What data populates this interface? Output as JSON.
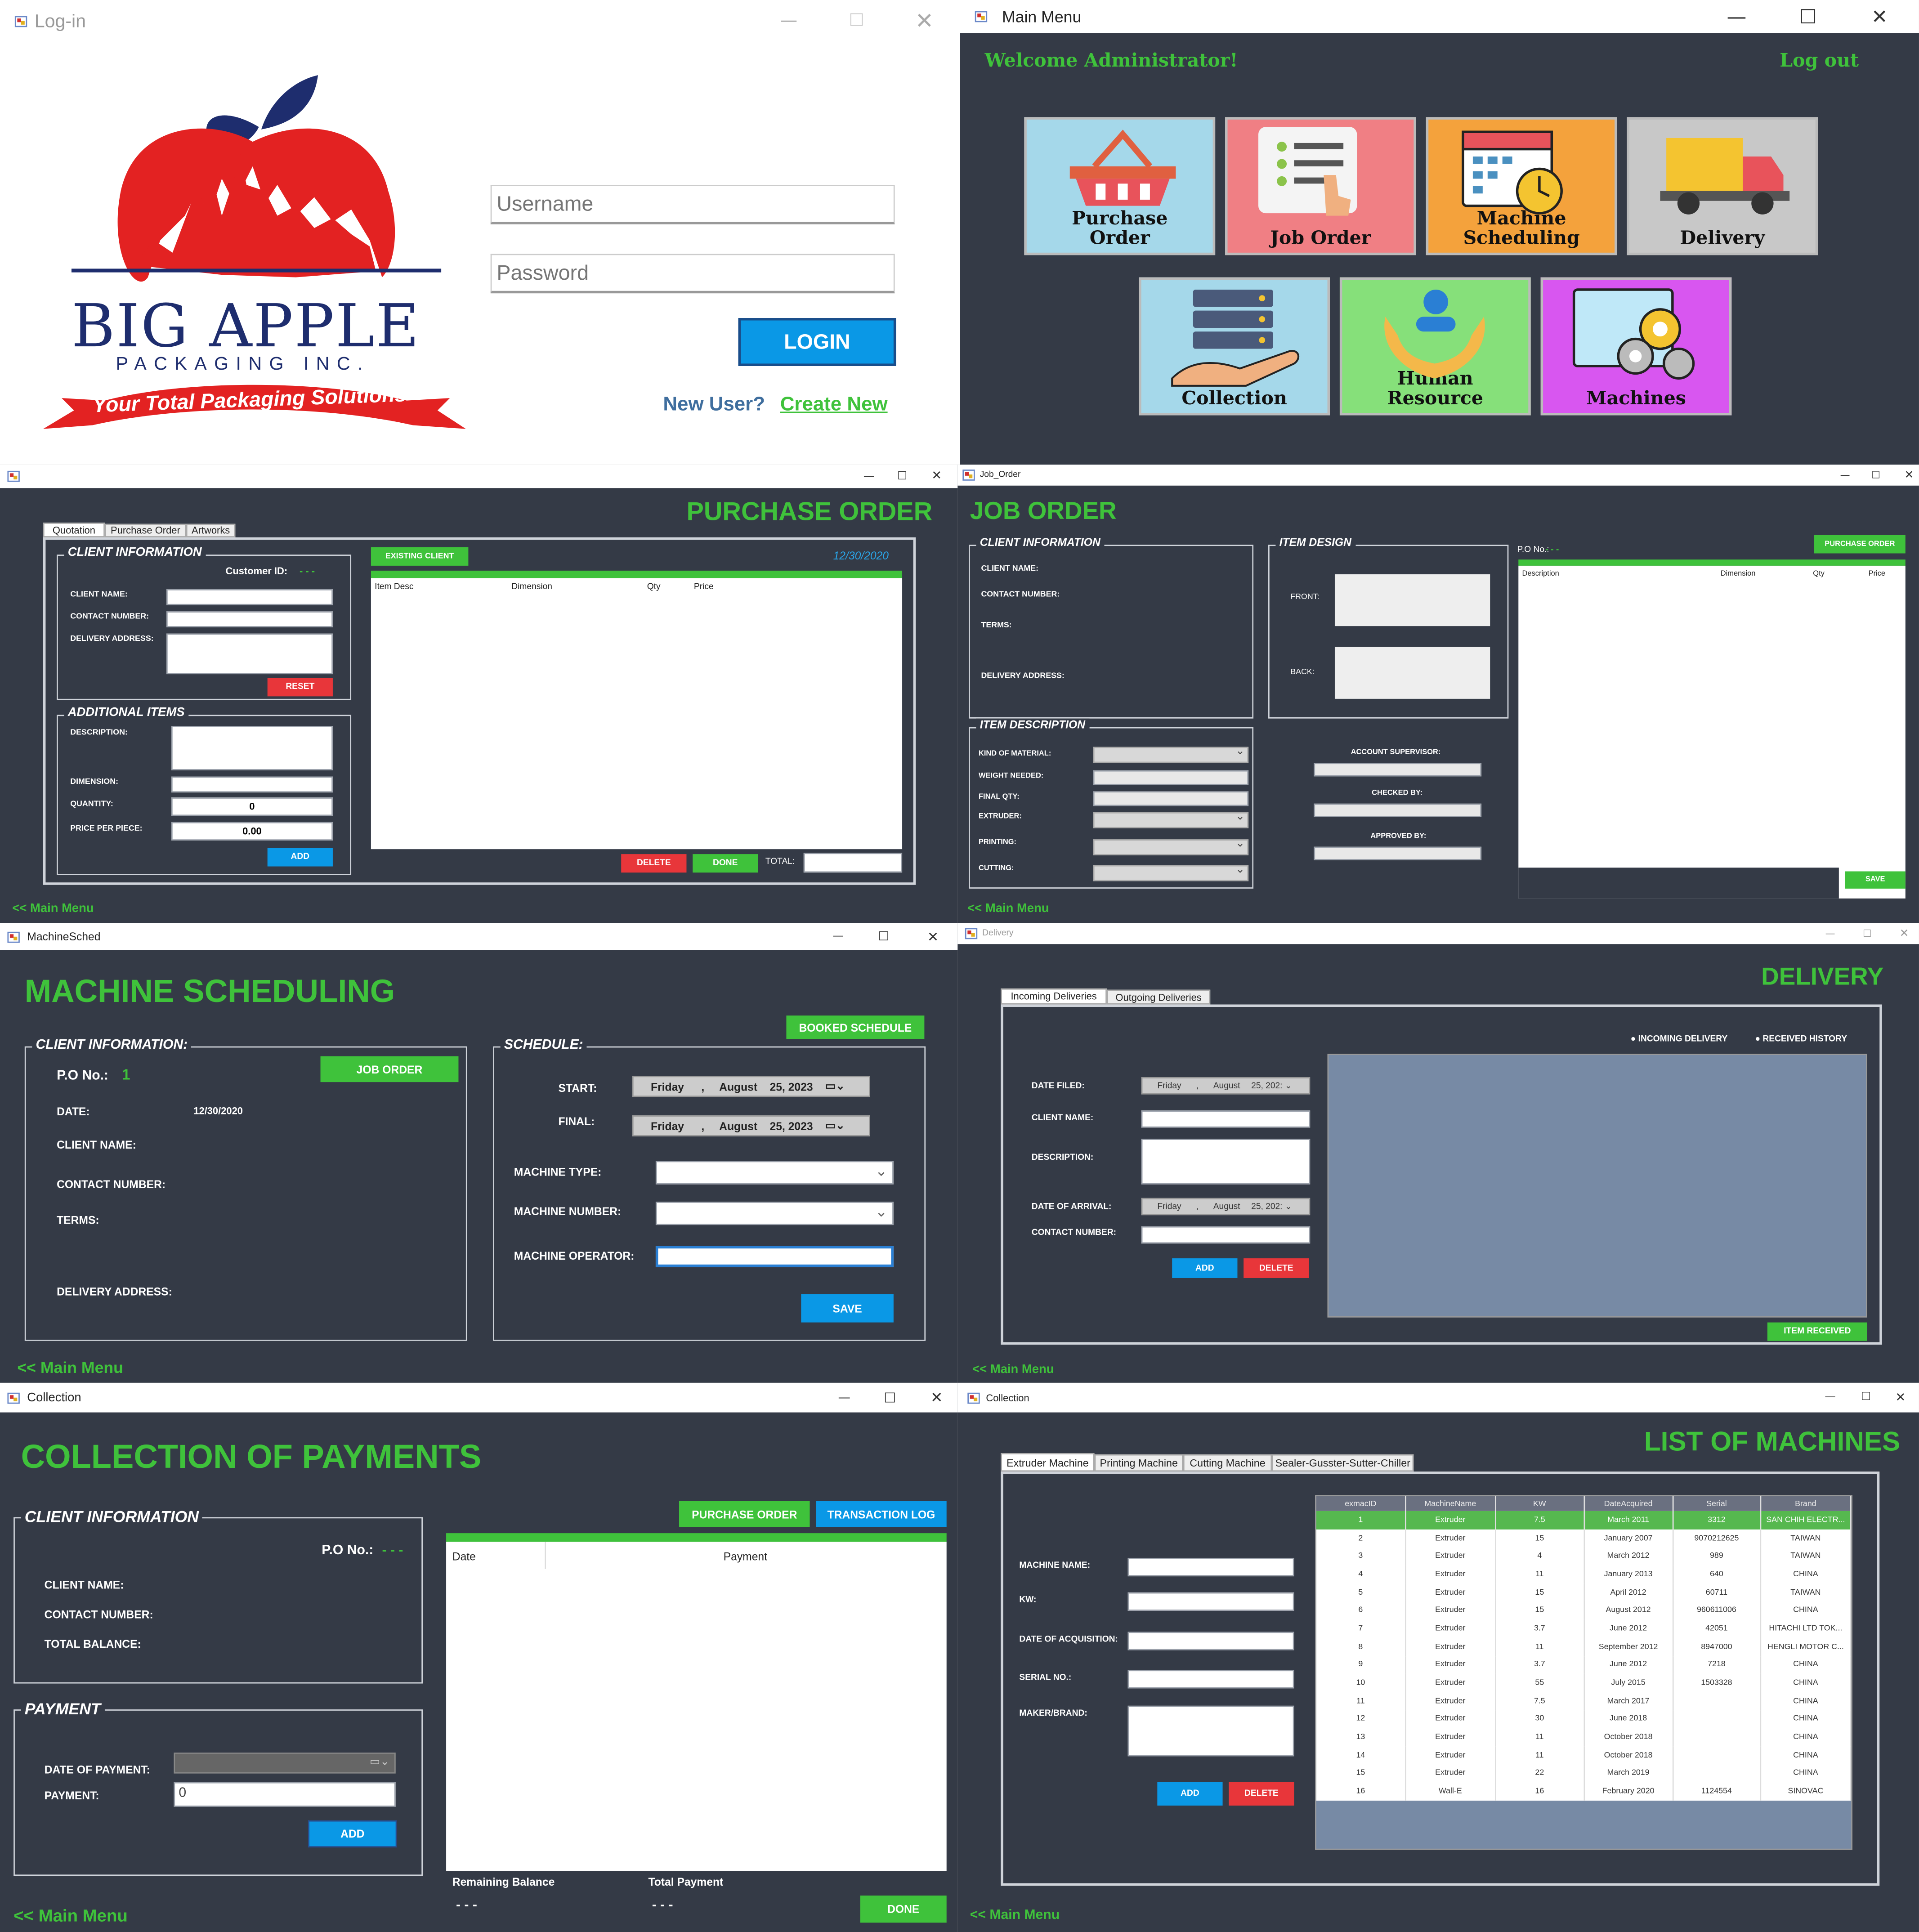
{
  "login": {
    "title": "Log-in",
    "logo_line1": "BIG APPLE",
    "logo_line2": "PACKAGING INC.",
    "logo_banner": "Your Total Packaging Solutions",
    "username_ph": "Username",
    "password_ph": "Password",
    "login_btn": "LOGIN",
    "new_user": "New User?",
    "create_new": "Create New"
  },
  "main_menu": {
    "title": "Main Menu",
    "welcome": "Welcome Administrator!",
    "logout": "Log out",
    "tiles": [
      "Purchase Order",
      "Job Order",
      "Machine Scheduling",
      "Delivery",
      "Collection",
      "Human Resource",
      "Machines"
    ]
  },
  "purchase_order": {
    "heading": "PURCHASE ORDER",
    "tabs": [
      "Quotation",
      "Purchase Order",
      "Artworks"
    ],
    "client_info": "CLIENT INFORMATION",
    "customer_id": "Customer ID:",
    "customer_id_val": "- - -",
    "client_name": "CLIENT NAME:",
    "contact_number": "CONTACT NUMBER:",
    "delivery_address": "DELIVERY ADDRESS:",
    "reset": "RESET",
    "additional_items": "ADDITIONAL ITEMS",
    "description": "DESCRIPTION:",
    "dimension": "DIMENSION:",
    "quantity": "QUANTITY:",
    "quantity_val": "0",
    "price_per_piece": "PRICE PER PIECE:",
    "price_val": "0.00",
    "add": "ADD",
    "existing_client": "EXISTING CLIENT",
    "date": "12/30/2020",
    "cols": [
      "Item Desc",
      "Dimension",
      "Qty",
      "Price"
    ],
    "delete": "DELETE",
    "done": "DONE",
    "total": "TOTAL:",
    "back": "<< Main Menu"
  },
  "job_order": {
    "title": "Job_Order",
    "heading": "JOB ORDER",
    "client_info": "CLIENT INFORMATION",
    "client_name": "CLIENT NAME:",
    "contact_number": "CONTACT NUMBER:",
    "terms": "TERMS:",
    "delivery_address": "DELIVERY ADDRESS:",
    "item_design": "ITEM DESIGN",
    "front": "FRONT:",
    "back_lbl": "BACK:",
    "item_description": "ITEM DESCRIPTION",
    "kind": "KIND OF MATERIAL:",
    "weight": "WEIGHT NEEDED:",
    "final_qty": "FINAL QTY:",
    "extruder": "EXTRUDER:",
    "printing": "PRINTING:",
    "cutting": "CUTTING:",
    "account_supervisor": "ACCOUNT SUPERVISOR:",
    "checked_by": "CHECKED BY:",
    "approved_by": "APPROVED BY:",
    "po_no": "P.O No.:",
    "po_val": "- - -",
    "purchase_order_btn": "PURCHASE ORDER",
    "cols": [
      "Description",
      "Dimension",
      "Qty",
      "Price"
    ],
    "save": "SAVE",
    "back": "<< Main Menu"
  },
  "machine_sched": {
    "title": "MachineSched",
    "heading": "MACHINE SCHEDULING",
    "client_info": "CLIENT INFORMATION:",
    "po_no": "P.O No.:",
    "po_val": "1",
    "job_order": "JOB ORDER",
    "date": "DATE:",
    "date_val": "12/30/2020",
    "client_name": "CLIENT NAME:",
    "contact_number": "CONTACT NUMBER:",
    "terms": "TERMS:",
    "delivery_address": "DELIVERY ADDRESS:",
    "booked": "BOOKED SCHEDULE",
    "schedule": "SCHEDULE:",
    "start": "START:",
    "final": "FINAL:",
    "day": "Friday",
    "month": "August",
    "dayyear": "25, 2023",
    "machine_type": "MACHINE TYPE:",
    "machine_number": "MACHINE NUMBER:",
    "machine_operator": "MACHINE OPERATOR:",
    "save": "SAVE",
    "back": "<< Main Menu"
  },
  "delivery": {
    "title": "Delivery",
    "heading": "DELIVERY",
    "tabs": [
      "Incoming Deliveries",
      "Outgoing Deliveries"
    ],
    "radio1": "INCOMING DELIVERY",
    "radio2": "RECEIVED HISTORY",
    "date_filed": "DATE FILED:",
    "client_name": "CLIENT NAME:",
    "description": "DESCRIPTION:",
    "date_arrival": "DATE OF ARRIVAL:",
    "contact_number": "CONTACT NUMBER:",
    "day": "Friday",
    "month": "August",
    "dayyear": "25, 202:",
    "add": "ADD",
    "delete": "DELETE",
    "item_received": "ITEM RECEIVED",
    "back": "<< Main Menu"
  },
  "collection": {
    "title": "Collection",
    "heading": "COLLECTION OF PAYMENTS",
    "client_info": "CLIENT INFORMATION",
    "po_no": "P.O No.:",
    "po_val": "- - -",
    "client_name": "CLIENT NAME:",
    "contact_number": "CONTACT NUMBER:",
    "total_balance": "TOTAL BALANCE:",
    "payment": "PAYMENT",
    "date_payment": "DATE OF PAYMENT:",
    "payment_lbl": "PAYMENT:",
    "payment_val": "0",
    "add": "ADD",
    "purchase_order_btn": "PURCHASE ORDER",
    "transaction_log": "TRANSACTION LOG",
    "cols": [
      "Date",
      "Payment"
    ],
    "remaining": "Remaining Balance",
    "total_payment": "Total Payment",
    "remaining_val": "- - -",
    "total_val": "- - -",
    "done": "DONE",
    "back": "<< Main Menu"
  },
  "machines": {
    "title": "Collection",
    "heading": "LIST OF MACHINES",
    "tabs": [
      "Extruder Machine",
      "Printing Machine",
      "Cutting Machine",
      "Sealer-Gusster-Sutter-Chiller"
    ],
    "machine_name": "MACHINE NAME:",
    "kw": "KW:",
    "date_acq": "DATE OF ACQUISITION:",
    "serial": "SERIAL NO.:",
    "maker": "MAKER/BRAND:",
    "add": "ADD",
    "delete": "DELETE",
    "cols": [
      "exmacID",
      "MachineName",
      "KW",
      "DateAcquired",
      "Serial",
      "Brand"
    ],
    "rows": [
      [
        "1",
        "Extruder",
        "7.5",
        "March 2011",
        "3312",
        "SAN CHIH ELECTR..."
      ],
      [
        "2",
        "Extruder",
        "15",
        "January 2007",
        "9070212625",
        "TAIWAN"
      ],
      [
        "3",
        "Extruder",
        "4",
        "March 2012",
        "989",
        "TAIWAN"
      ],
      [
        "4",
        "Extruder",
        "11",
        "January 2013",
        "640",
        "CHINA"
      ],
      [
        "5",
        "Extruder",
        "15",
        "April 2012",
        "60711",
        "TAIWAN"
      ],
      [
        "6",
        "Extruder",
        "15",
        "August 2012",
        "960611006",
        "CHINA"
      ],
      [
        "7",
        "Extruder",
        "3.7",
        "June 2012",
        "42051",
        "HITACHI LTD TOK..."
      ],
      [
        "8",
        "Extruder",
        "11",
        "September 2012",
        "8947000",
        "HENGLI MOTOR C..."
      ],
      [
        "9",
        "Extruder",
        "3.7",
        "June 2012",
        "7218",
        "CHINA"
      ],
      [
        "10",
        "Extruder",
        "55",
        "July 2015",
        "1503328",
        "CHINA"
      ],
      [
        "11",
        "Extruder",
        "7.5",
        "March 2017",
        "",
        "CHINA"
      ],
      [
        "12",
        "Extruder",
        "30",
        "June 2018",
        "",
        "CHINA"
      ],
      [
        "13",
        "Extruder",
        "11",
        "October 2018",
        "",
        "CHINA"
      ],
      [
        "14",
        "Extruder",
        "11",
        "October 2018",
        "",
        "CHINA"
      ],
      [
        "15",
        "Extruder",
        "22",
        "March 2019",
        "",
        "CHINA"
      ],
      [
        "16",
        "Wall-E",
        "16",
        "February 2020",
        "1124554",
        "SINOVAC"
      ]
    ],
    "back": "<< Main Menu"
  }
}
